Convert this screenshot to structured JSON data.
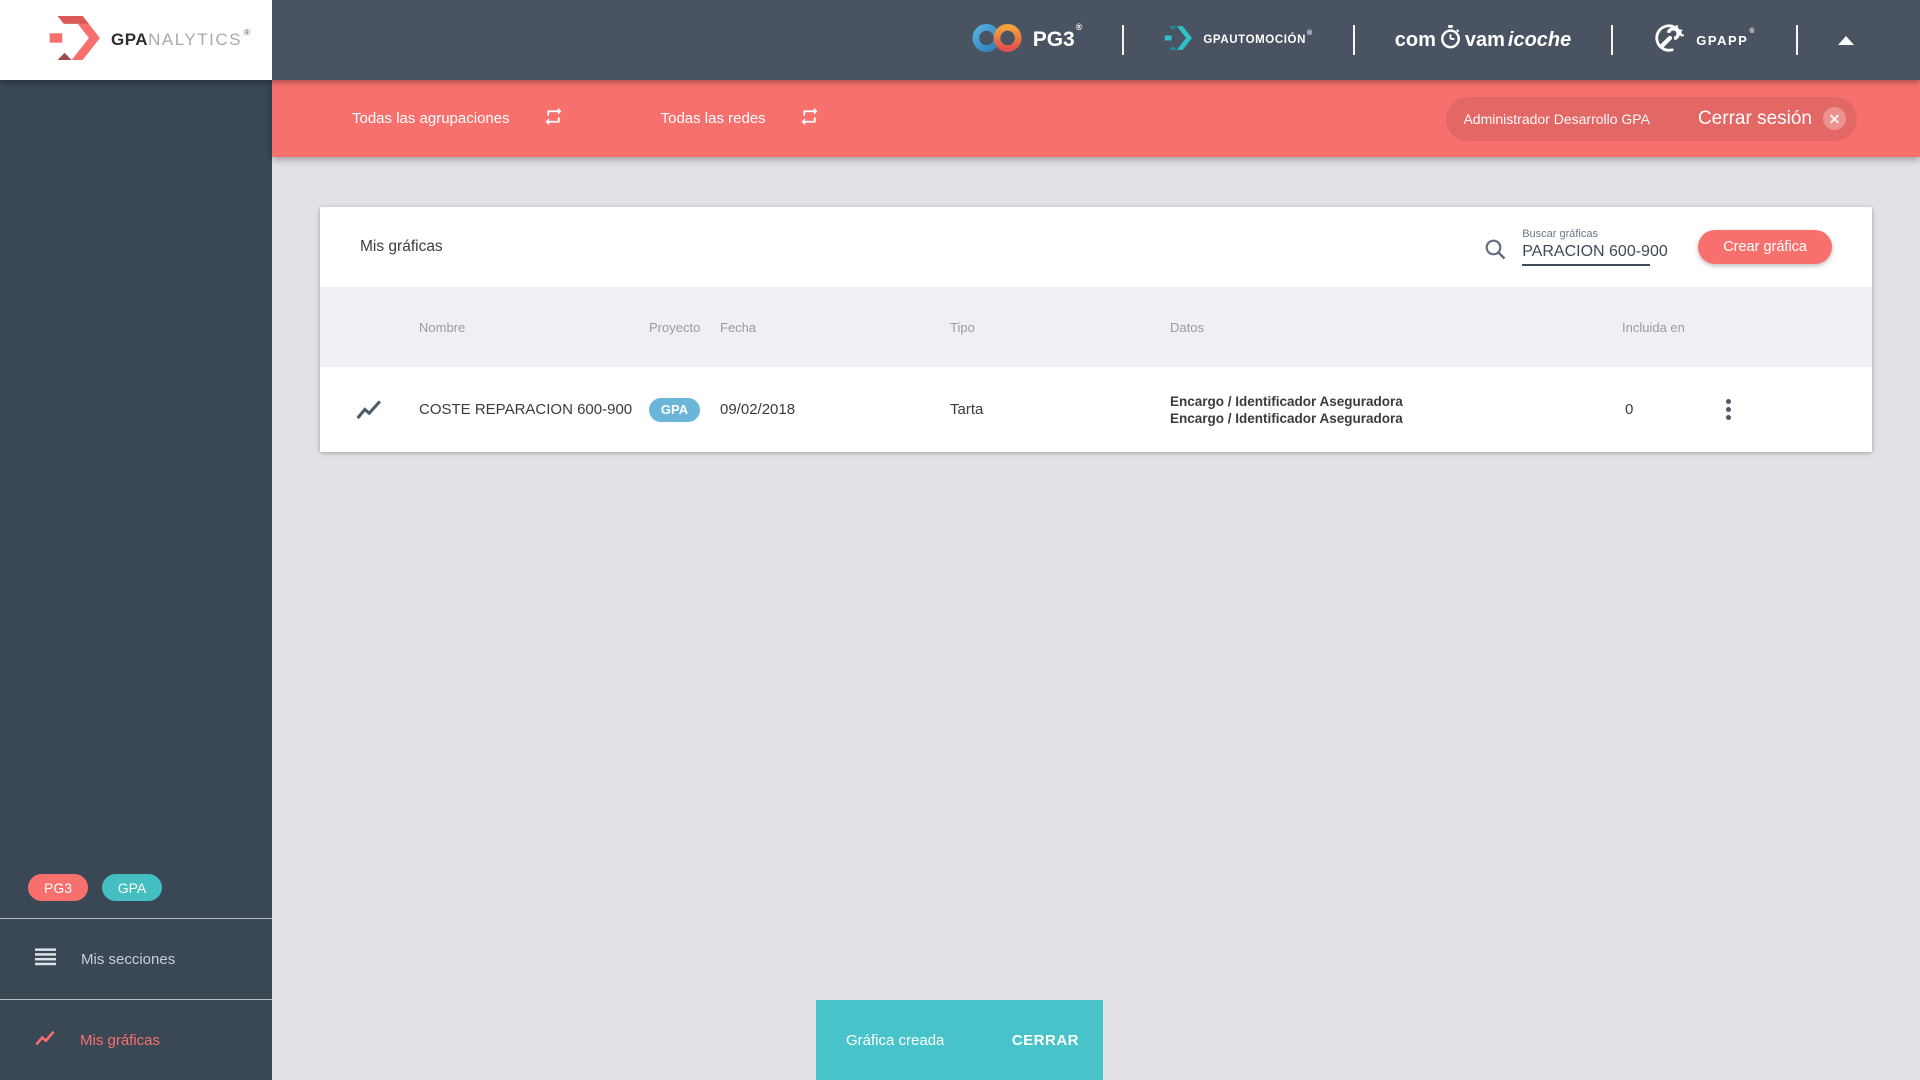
{
  "colors": {
    "coral_accent": "#f7706d",
    "header_dark": "#4a5361",
    "sidebar_dark": "#3a4754",
    "snackbar_teal": "#47c3c9",
    "project_badge_blue": "#6ab5d8",
    "sidebar_badge_teal": "#45bec2",
    "page_background": "#e2e1e5"
  },
  "header": {
    "brand": {
      "bold": "GPA",
      "light": "NALYTICS",
      "reg": "®"
    },
    "pg3": {
      "label": "PG3",
      "reg": "®"
    },
    "gpautomocion": {
      "label": "GPAUTOMOCIÓN",
      "reg": "®"
    },
    "comvamicoche": {
      "part1": "com",
      "part2": "vam",
      "part3": "icoche"
    },
    "gpapp": {
      "label": "GPAPP",
      "reg": "®"
    }
  },
  "filter_bar": {
    "groupings": "Todas las agrupaciones",
    "networks": "Todas las redes",
    "user": "Administrador Desarrollo GPA",
    "logout": "Cerrar sesión"
  },
  "sidebar": {
    "badge_pg3": "PG3",
    "badge_gpa": "GPA",
    "items": [
      {
        "label": "Mis secciones"
      },
      {
        "label": "Mis gráficas"
      }
    ]
  },
  "page": {
    "title": "Mis gráficas",
    "search_label": "Buscar gráficas",
    "search_value": "PARACION 600-900",
    "create_button": "Crear gráfica"
  },
  "table": {
    "headers": {
      "name": "Nombre",
      "project": "Proyecto",
      "date": "Fecha",
      "type": "Tipo",
      "data": "Datos",
      "included": "Incluida en"
    },
    "rows": [
      {
        "name": "COSTE REPARACION 600-900",
        "project_badge": "GPA",
        "date": "09/02/2018",
        "type": "Tarta",
        "data_line1": "Encargo / Identificador Aseguradora",
        "data_line2": "Encargo / Identificador Aseguradora",
        "included_in": "0"
      }
    ]
  },
  "snackbar": {
    "message": "Gráfica creada",
    "action": "CERRAR"
  }
}
